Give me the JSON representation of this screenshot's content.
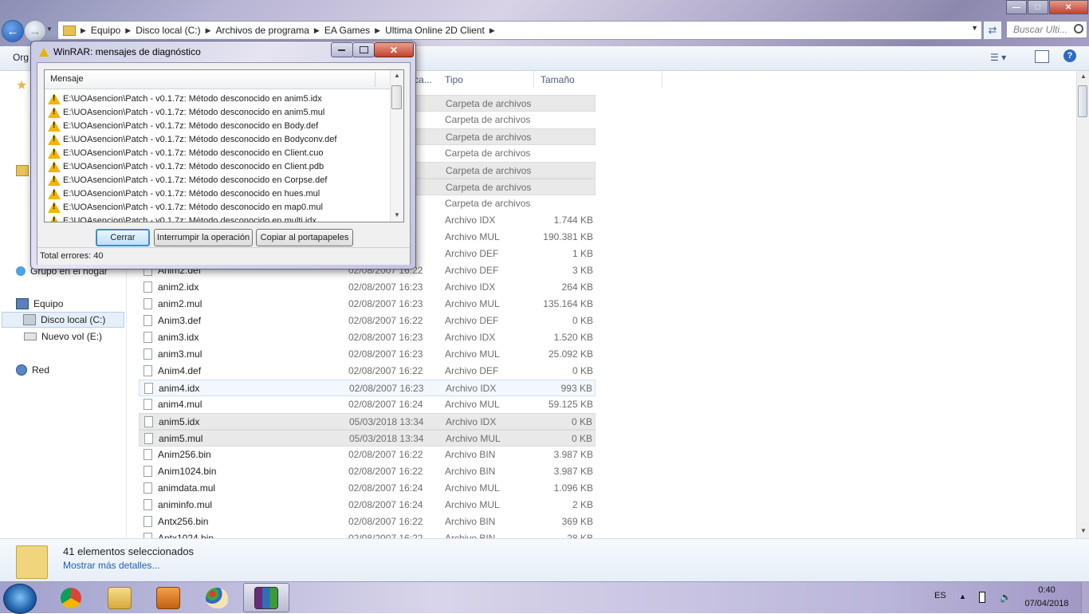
{
  "explorer": {
    "breadcrumb": [
      "Equipo",
      "Disco local (C:)",
      "Archivos de programa",
      "EA Games",
      "Ultima Online 2D Client"
    ],
    "search_placeholder": "Buscar Ulti...",
    "toolbar": {
      "organize_label": "Org"
    },
    "columns": {
      "date": "ca...",
      "type": "Tipo",
      "size": "Tamaño"
    },
    "nav": {
      "homegroup": "Grupo en el hogar",
      "computer": "Equipo",
      "disk_c": "Disco local (C:)",
      "disk_e": "Nuevo vol (E:)",
      "network": "Red"
    },
    "folder_rows": [
      {
        "type": "Carpeta de archivos"
      },
      {
        "type": "Carpeta de archivos"
      },
      {
        "type": "Carpeta de archivos"
      },
      {
        "type": "Carpeta de archivos"
      },
      {
        "type": "Carpeta de archivos"
      },
      {
        "type": "Carpeta de archivos"
      },
      {
        "type": "Carpeta de archivos"
      }
    ],
    "partial_rows": [
      {
        "date": "3",
        "type": "Archivo IDX",
        "size": "1.744 KB"
      },
      {
        "date": "3",
        "type": "Archivo MUL",
        "size": "190.381 KB"
      },
      {
        "date": "2",
        "type": "Archivo DEF",
        "size": "1 KB"
      }
    ],
    "files": [
      {
        "name": "Anim2.def",
        "date": "02/08/2007 16:22",
        "type": "Archivo DEF",
        "size": "3 KB"
      },
      {
        "name": "anim2.idx",
        "date": "02/08/2007 16:23",
        "type": "Archivo IDX",
        "size": "264 KB"
      },
      {
        "name": "anim2.mul",
        "date": "02/08/2007 16:23",
        "type": "Archivo MUL",
        "size": "135.164 KB"
      },
      {
        "name": "Anim3.def",
        "date": "02/08/2007 16:22",
        "type": "Archivo DEF",
        "size": "0 KB"
      },
      {
        "name": "anim3.idx",
        "date": "02/08/2007 16:23",
        "type": "Archivo IDX",
        "size": "1.520 KB"
      },
      {
        "name": "anim3.mul",
        "date": "02/08/2007 16:23",
        "type": "Archivo MUL",
        "size": "25.092 KB"
      },
      {
        "name": "Anim4.def",
        "date": "02/08/2007 16:22",
        "type": "Archivo DEF",
        "size": "0 KB"
      },
      {
        "name": "anim4.idx",
        "date": "02/08/2007 16:23",
        "type": "Archivo IDX",
        "size": "993 KB"
      },
      {
        "name": "anim4.mul",
        "date": "02/08/2007 16:24",
        "type": "Archivo MUL",
        "size": "59.125 KB"
      },
      {
        "name": "anim5.idx",
        "date": "05/03/2018 13:34",
        "type": "Archivo IDX",
        "size": "0 KB"
      },
      {
        "name": "anim5.mul",
        "date": "05/03/2018 13:34",
        "type": "Archivo MUL",
        "size": "0 KB"
      },
      {
        "name": "Anim256.bin",
        "date": "02/08/2007 16:22",
        "type": "Archivo BIN",
        "size": "3.987 KB"
      },
      {
        "name": "Anim1024.bin",
        "date": "02/08/2007 16:22",
        "type": "Archivo BIN",
        "size": "3.987 KB"
      },
      {
        "name": "animdata.mul",
        "date": "02/08/2007 16:24",
        "type": "Archivo MUL",
        "size": "1.096 KB"
      },
      {
        "name": "animinfo.mul",
        "date": "02/08/2007 16:24",
        "type": "Archivo MUL",
        "size": "2 KB"
      },
      {
        "name": "Antx256.bin",
        "date": "02/08/2007 16:22",
        "type": "Archivo BIN",
        "size": "369 KB"
      },
      {
        "name": "Antx1024.bin",
        "date": "02/08/2007 16:22",
        "type": "Archivo BIN",
        "size": "28 KB"
      }
    ],
    "details": {
      "count": "41 elementos seleccionados",
      "more": "Mostrar más detalles..."
    }
  },
  "dialog": {
    "title": "WinRAR: mensajes de diagnóstico",
    "column": "Mensaje",
    "messages": [
      "E:\\UOAsencion\\Patch - v0.1.7z: Método desconocido en anim5.idx",
      "E:\\UOAsencion\\Patch - v0.1.7z: Método desconocido en anim5.mul",
      "E:\\UOAsencion\\Patch - v0.1.7z: Método desconocido en Body.def",
      "E:\\UOAsencion\\Patch - v0.1.7z: Método desconocido en Bodyconv.def",
      "E:\\UOAsencion\\Patch - v0.1.7z: Método desconocido en Client.cuo",
      "E:\\UOAsencion\\Patch - v0.1.7z: Método desconocido en Client.pdb",
      "E:\\UOAsencion\\Patch - v0.1.7z: Método desconocido en Corpse.def",
      "E:\\UOAsencion\\Patch - v0.1.7z: Método desconocido en hues.mul",
      "E:\\UOAsencion\\Patch - v0.1.7z: Método desconocido en map0.mul",
      "E:\\UOAsencion\\Patch - v0.1.7z: Método desconocido en multi.idx"
    ],
    "buttons": {
      "close": "Cerrar",
      "stop": "Interrumpir la operación",
      "copy": "Copiar al portapapeles"
    },
    "status": "Total errores: 40"
  },
  "taskbar": {
    "lang": "ES",
    "time": "0:40",
    "date": "07/04/2018",
    "apps": [
      "chrome-icon",
      "explorer-icon",
      "media-player-icon",
      "paint-icon",
      "winrar-icon"
    ]
  }
}
